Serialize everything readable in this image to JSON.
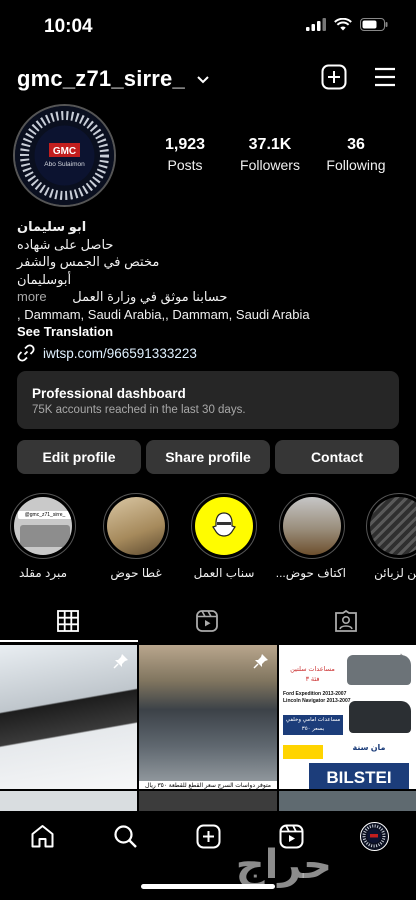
{
  "status_bar": {
    "time": "10:04"
  },
  "header": {
    "username": "gmc_z71_sirre_"
  },
  "profile": {
    "avatar_text_top": "GMC",
    "avatar_text_bottom": "Abo Sulaimon",
    "stats": [
      {
        "value": "1,923",
        "label": "Posts"
      },
      {
        "value": "37.1K",
        "label": "Followers"
      },
      {
        "value": "36",
        "label": "Following"
      }
    ],
    "name": "ابو سليمان",
    "bio_lines": [
      "حاصل على شهاده",
      "مختص في الجمس والشفر",
      "أبوسليمان"
    ],
    "bio_more_line": "حسابنا موثق في وزارة العمل",
    "more_label": "more",
    "location_line": ", Dammam, Saudi Arabia,, Dammam, Saudi Arabia",
    "see_translation": "See Translation",
    "link": "iwtsp.com/966591333223"
  },
  "dashboard": {
    "title": "Professional dashboard",
    "subtitle": "75K accounts reached in the last 30 days."
  },
  "buttons": {
    "edit": "Edit profile",
    "share": "Share profile",
    "contact": "Contact"
  },
  "highlights": [
    {
      "label": "مبرد مقلد",
      "thumb_text": "@gmc_z71_sirre_"
    },
    {
      "label": "غطا حوض"
    },
    {
      "label": "سناب العمل"
    },
    {
      "label": "اكتاف حوض..."
    },
    {
      "label": "حن لزبائن"
    }
  ],
  "grid": {
    "post2_caption": "متوفر دواسات السرج سعر القطع للقطعة ٣٥٠ ريال",
    "post3_texts": {
      "l1": "مساعدات سلتين",
      "l2": "فئة ٣",
      "l3": "Ford Expedition 2013-2007",
      "l4": "Lincoln Navigator 2013-2007",
      "l5": "مساعدات امامي وخلفي",
      "l6": "بسعر ٣٥٠",
      "l7": "مان سنة",
      "l8": "BILSTEI"
    }
  },
  "watermark": "حراج",
  "colors": {
    "background": "#000000",
    "button_bg": "#363636",
    "dashboard_bg": "#262626",
    "secondary_text": "#a8a8a8"
  }
}
